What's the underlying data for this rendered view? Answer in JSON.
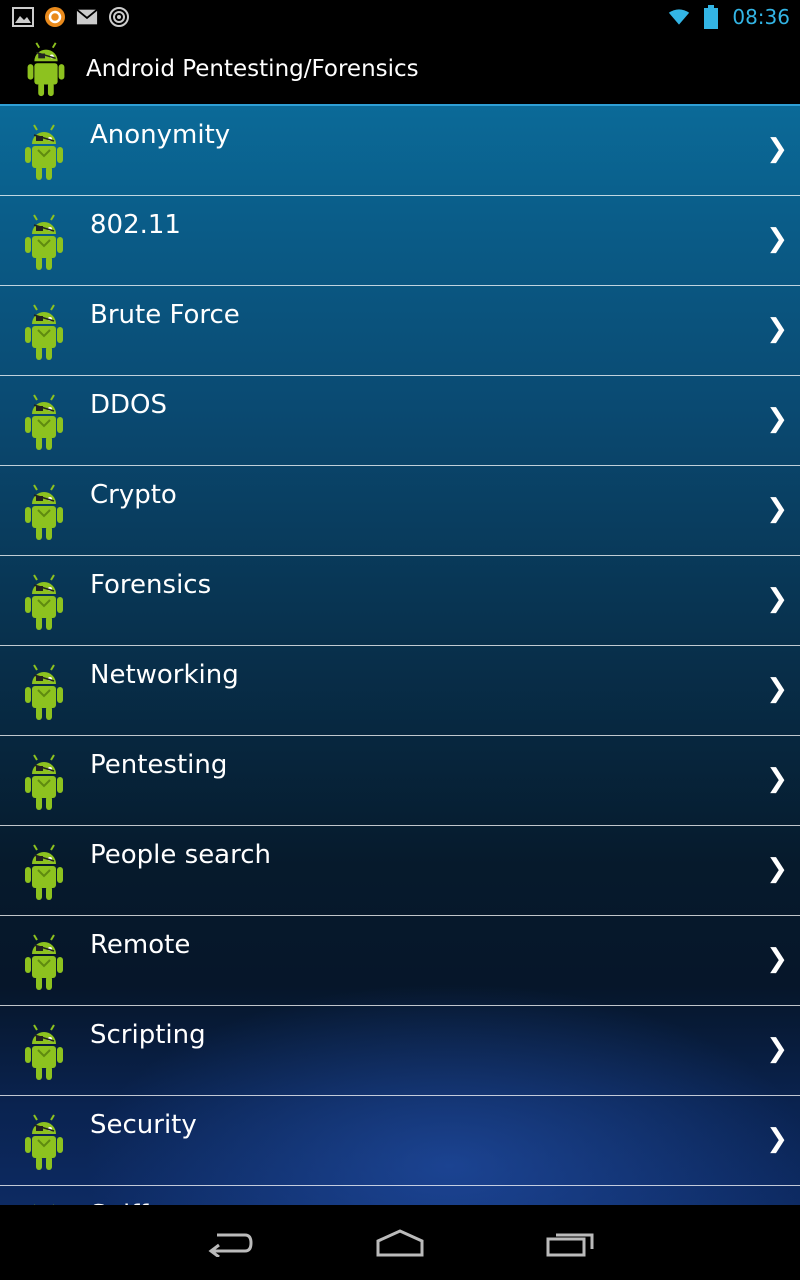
{
  "status_bar": {
    "time": "08:36",
    "icons": [
      "image-icon",
      "app-circle-icon",
      "mail-icon",
      "target-icon",
      "wifi-icon",
      "battery-icon"
    ],
    "time_color": "#33b5e5"
  },
  "action_bar": {
    "title": "Android Pentesting/Forensics",
    "accent_color": "#2f9fd6"
  },
  "list": {
    "items": [
      {
        "label": "Anonymity"
      },
      {
        "label": "802.11"
      },
      {
        "label": "Brute Force"
      },
      {
        "label": "DDOS"
      },
      {
        "label": "Crypto"
      },
      {
        "label": "Forensics"
      },
      {
        "label": "Networking"
      },
      {
        "label": "Pentesting"
      },
      {
        "label": "People search"
      },
      {
        "label": "Remote"
      },
      {
        "label": "Scripting"
      },
      {
        "label": "Security"
      },
      {
        "label": "Sniffers"
      }
    ],
    "chevron": "❯"
  },
  "nav_bar": {
    "icons": [
      "back-icon",
      "home-icon",
      "recents-icon"
    ]
  }
}
